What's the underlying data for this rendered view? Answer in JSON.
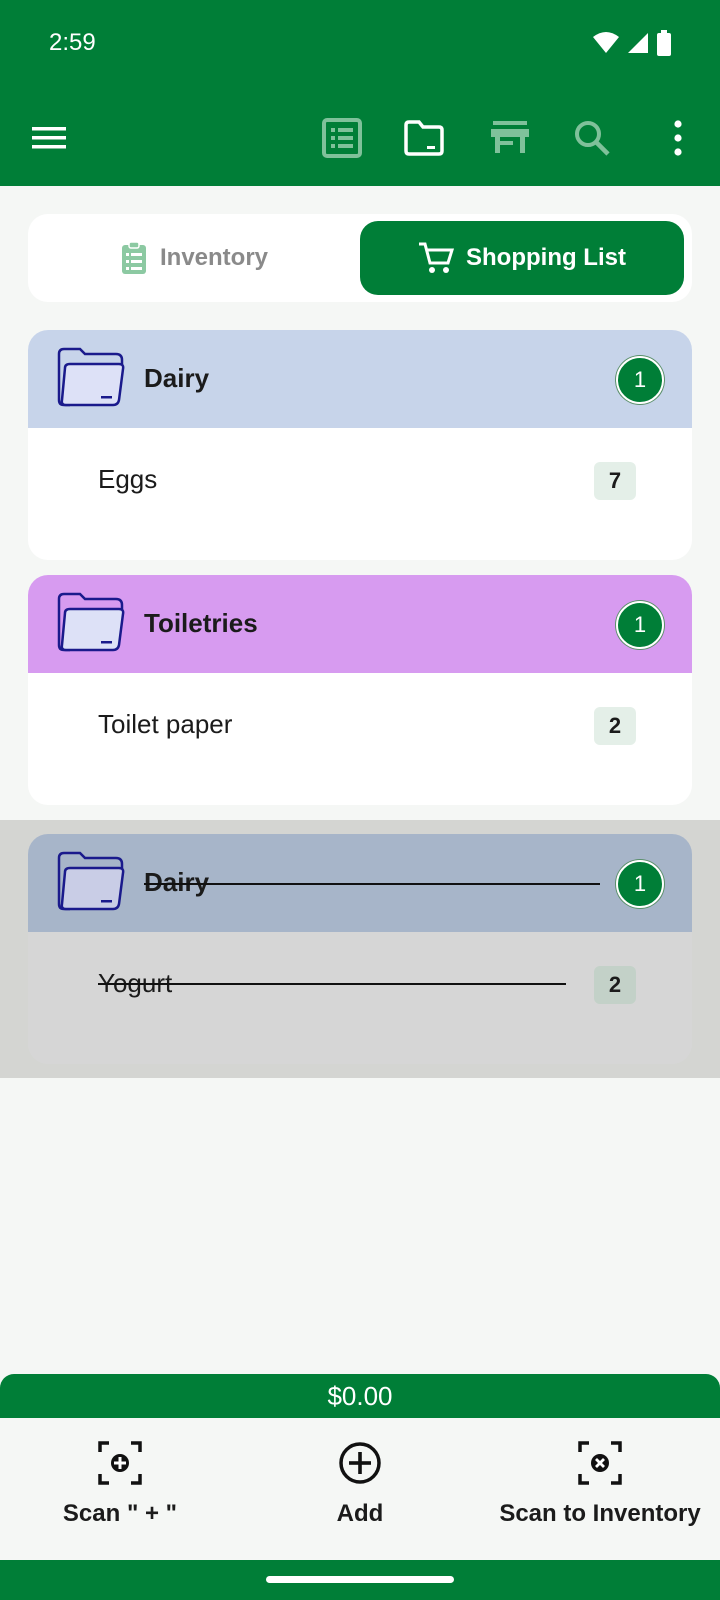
{
  "status": {
    "time": "2:59"
  },
  "app_bar": {
    "icons": [
      "menu-icon",
      "list-icon",
      "folder-icon",
      "store-icon",
      "search-icon",
      "more-vert-icon"
    ]
  },
  "segmented": {
    "inventory_label": "Inventory",
    "shopping_label": "Shopping List",
    "selected": "Shopping List"
  },
  "groups": [
    {
      "title": "Dairy",
      "count": "1",
      "color": "#c7d4ea",
      "items": [
        {
          "name": "Eggs",
          "qty": "7"
        }
      ]
    },
    {
      "title": "Toiletries",
      "count": "1",
      "color": "#d79bf0",
      "items": [
        {
          "name": "Toilet paper",
          "qty": "2"
        }
      ]
    }
  ],
  "done_groups": [
    {
      "title": "Dairy",
      "count": "1",
      "color": "#a7b5c9",
      "items": [
        {
          "name": "Yogurt",
          "qty": "2"
        }
      ]
    }
  ],
  "total": "$0.00",
  "bottom_actions": [
    {
      "label": "Scan \" + \"",
      "icon": "scan-add-icon"
    },
    {
      "label": "Add",
      "icon": "add-circle-icon"
    },
    {
      "label": "Scan to Inventory",
      "icon": "scan-remove-icon"
    }
  ],
  "colors": {
    "primary": "#007e37",
    "folder_stroke": "#1a1a8c",
    "done_band": "#d4d5d2"
  }
}
